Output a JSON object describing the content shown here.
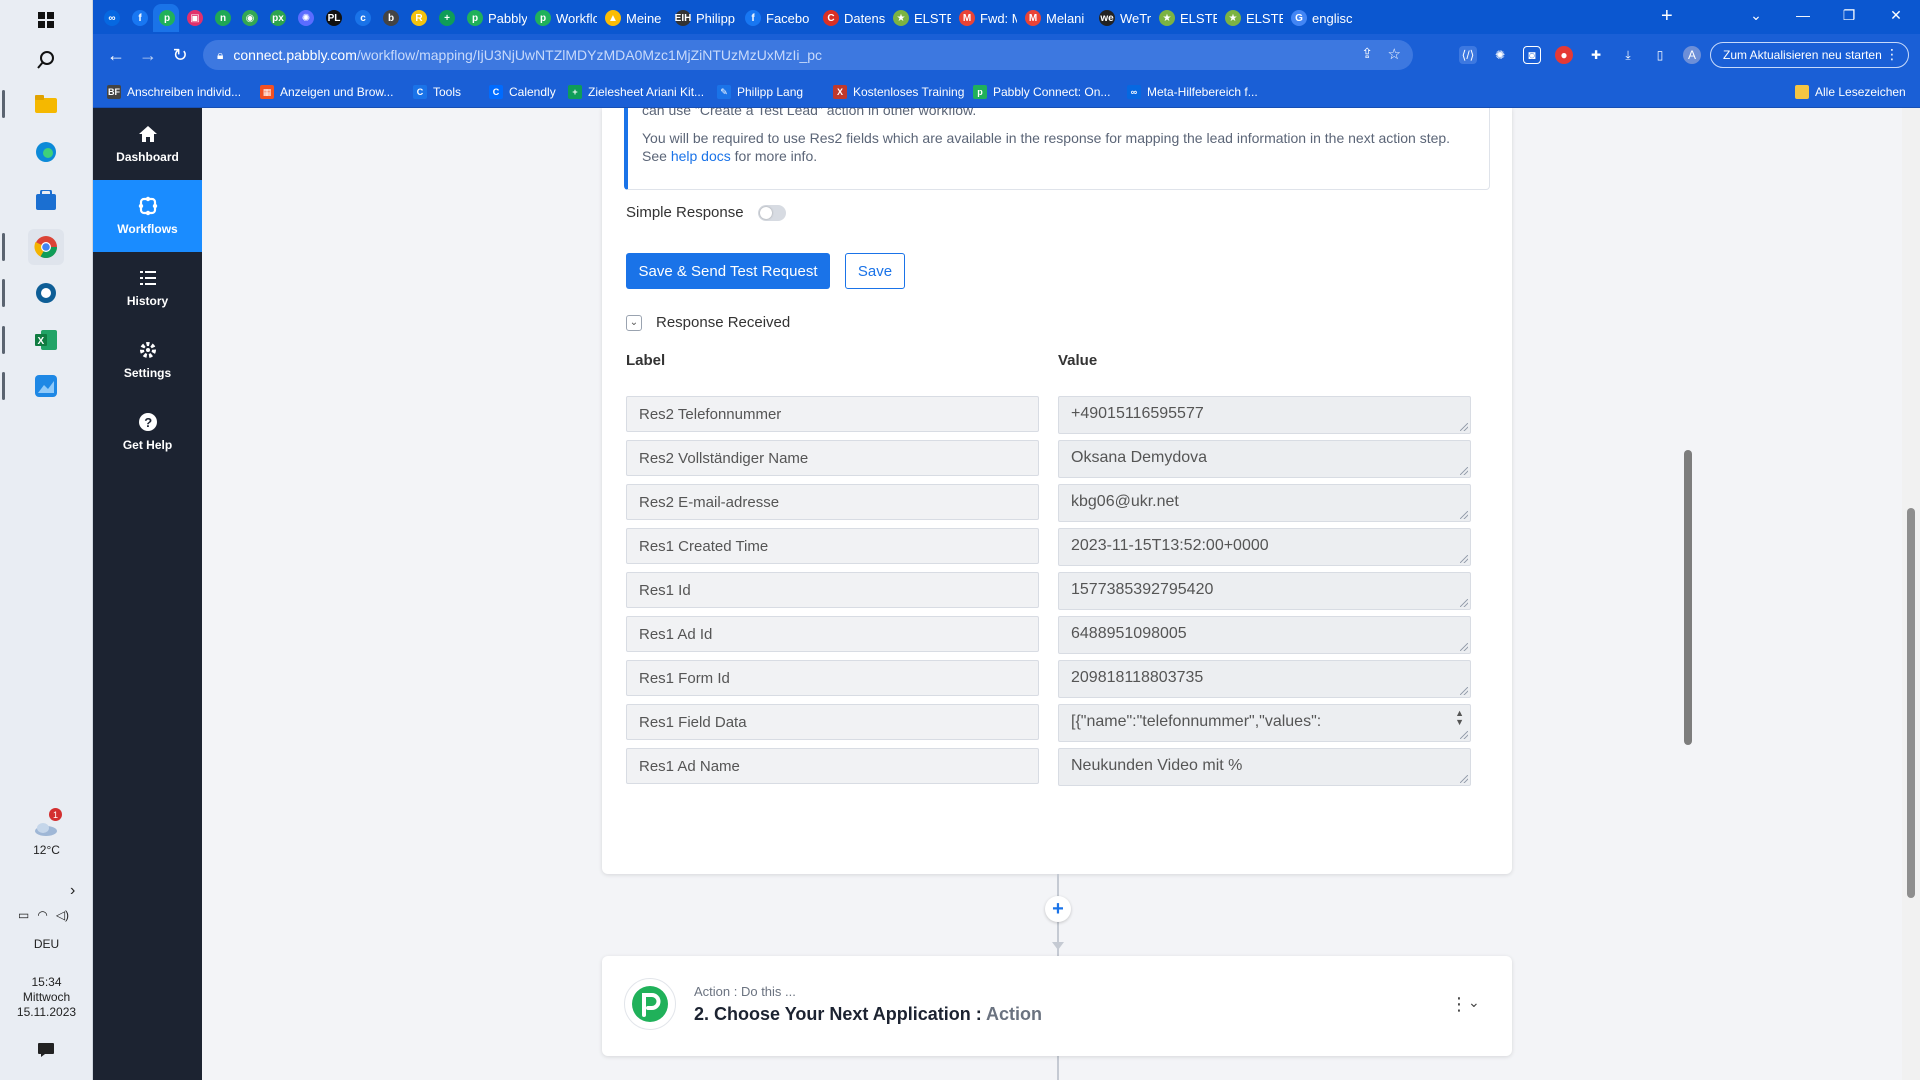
{
  "taskbar": {
    "weather": {
      "temp": "12°C",
      "badge": "1"
    },
    "language": "DEU",
    "clock": {
      "time": "15:34",
      "day": "Mittwoch",
      "date": "15.11.2023"
    }
  },
  "browser": {
    "tabs": [
      {
        "label": "",
        "color": "#0668E1",
        "glyph": "∞"
      },
      {
        "label": "",
        "color": "#1877F2",
        "glyph": "f"
      },
      {
        "label": "",
        "color": "#20b15a",
        "glyph": "p"
      },
      {
        "label": "",
        "color": "#e1306c",
        "glyph": "▣"
      },
      {
        "label": "",
        "color": "#1fa855",
        "glyph": "n"
      },
      {
        "label": "",
        "color": "#34a853",
        "glyph": "◉"
      },
      {
        "label": "",
        "color": "#2da44e",
        "glyph": "px"
      },
      {
        "label": "",
        "color": "#5b6cff",
        "glyph": "✺"
      },
      {
        "label": "",
        "color": "#111",
        "glyph": "PL"
      },
      {
        "label": "",
        "color": "#1a73e8",
        "glyph": "c"
      },
      {
        "label": "",
        "color": "#444",
        "glyph": "b"
      },
      {
        "label": "",
        "color": "#f4c20d",
        "glyph": "R"
      },
      {
        "label": "",
        "color": "#0f9d58",
        "glyph": "+"
      },
      {
        "label": "Pabbly",
        "color": "#20b15a",
        "glyph": "p"
      },
      {
        "label": "Workflo",
        "color": "#20b15a",
        "glyph": "p"
      },
      {
        "label": "Meine",
        "color": "#fbbc04",
        "glyph": "▲"
      },
      {
        "label": "Philipp",
        "color": "#333",
        "glyph": "EIH"
      },
      {
        "label": "Facebo",
        "color": "#1877F2",
        "glyph": "f"
      },
      {
        "label": "Datens",
        "color": "#d93025",
        "glyph": "C"
      },
      {
        "label": "ELSTER",
        "color": "#7cb342",
        "glyph": "★"
      },
      {
        "label": "Fwd: M",
        "color": "#ea4335",
        "glyph": "M"
      },
      {
        "label": "Melani",
        "color": "#ea4335",
        "glyph": "M"
      },
      {
        "label": "WeTran",
        "color": "#222",
        "glyph": "we"
      },
      {
        "label": "ELSTER",
        "color": "#7cb342",
        "glyph": "★"
      },
      {
        "label": "ELSTER",
        "color": "#7cb342",
        "glyph": "★"
      },
      {
        "label": "englisc",
        "color": "#4285f4",
        "glyph": "G"
      }
    ],
    "url_host": "connect.pabbly.com",
    "url_path": "/workflow/mapping/IjU3NjUwNTZlMDYzMDA0Mzc1MjZiNTUzMzUxMzIi_pc",
    "update_button": "Zum Aktualisieren neu starten",
    "profile_initial": "A",
    "bookmarks": [
      {
        "label": "Anschreiben individ...",
        "color": "#444",
        "glyph": "BF"
      },
      {
        "label": "Anzeigen und Brow...",
        "color": "#f25022",
        "glyph": "▦"
      },
      {
        "label": "Tools",
        "color": "#1a73e8",
        "glyph": "C"
      },
      {
        "label": "Calendly",
        "color": "#006bff",
        "glyph": "C"
      },
      {
        "label": "Zielesheet Ariani Kit...",
        "color": "#0f9d58",
        "glyph": "+"
      },
      {
        "label": "Philipp Lang",
        "color": "#1a73e8",
        "glyph": "✎"
      },
      {
        "label": "Kostenloses Training",
        "color": "#c0392b",
        "glyph": "X"
      },
      {
        "label": "Pabbly Connect: On...",
        "color": "#20b15a",
        "glyph": "p"
      },
      {
        "label": "Meta-Hilfebereich f...",
        "color": "#0668E1",
        "glyph": "∞"
      }
    ],
    "all_bookmarks": "Alle Lesezeichen"
  },
  "app_nav": [
    {
      "label": "Dashboard",
      "icon": "home-icon"
    },
    {
      "label": "Workflows",
      "icon": "workflow-icon"
    },
    {
      "label": "History",
      "icon": "history-icon"
    },
    {
      "label": "Settings",
      "icon": "gear-icon"
    },
    {
      "label": "Get Help",
      "icon": "help-icon"
    }
  ],
  "trigger_card": {
    "info_clipped": "can use \"Create a Test Lead\" action in other workflow.",
    "info_text": "You will be required to use Res2 fields which are available in the response for mapping the lead information in the next action step. See",
    "info_link": "help docs",
    "info_suffix": "for more info.",
    "simple_response_label": "Simple Response",
    "save_send_button": "Save & Send Test Request",
    "save_button": "Save",
    "response_received_label": "Response Received",
    "col_label": "Label",
    "col_value": "Value",
    "rows": [
      {
        "label": "Res2 Telefonnummer",
        "value": "+49015116595577"
      },
      {
        "label": "Res2 Vollständiger Name",
        "value": "Oksana Demydova"
      },
      {
        "label": "Res2 E-mail-adresse",
        "value": "kbg06@ukr.net"
      },
      {
        "label": "Res1 Created Time",
        "value": "2023-11-15T13:52:00+0000"
      },
      {
        "label": "Res1 Id",
        "value": "1577385392795420"
      },
      {
        "label": "Res1 Ad Id",
        "value": "6488951098005"
      },
      {
        "label": "Res1 Form Id",
        "value": "209818118803735"
      },
      {
        "label": "Res1 Field Data",
        "value": "[{\"name\":\"telefonnummer\",\"values\":"
      },
      {
        "label": "Res1 Ad Name",
        "value": "Neukunden Video mit %"
      }
    ]
  },
  "action_card": {
    "subtitle": "Action : Do this ...",
    "title": "2. Choose Your Next Application :",
    "title_muted": "Action"
  }
}
